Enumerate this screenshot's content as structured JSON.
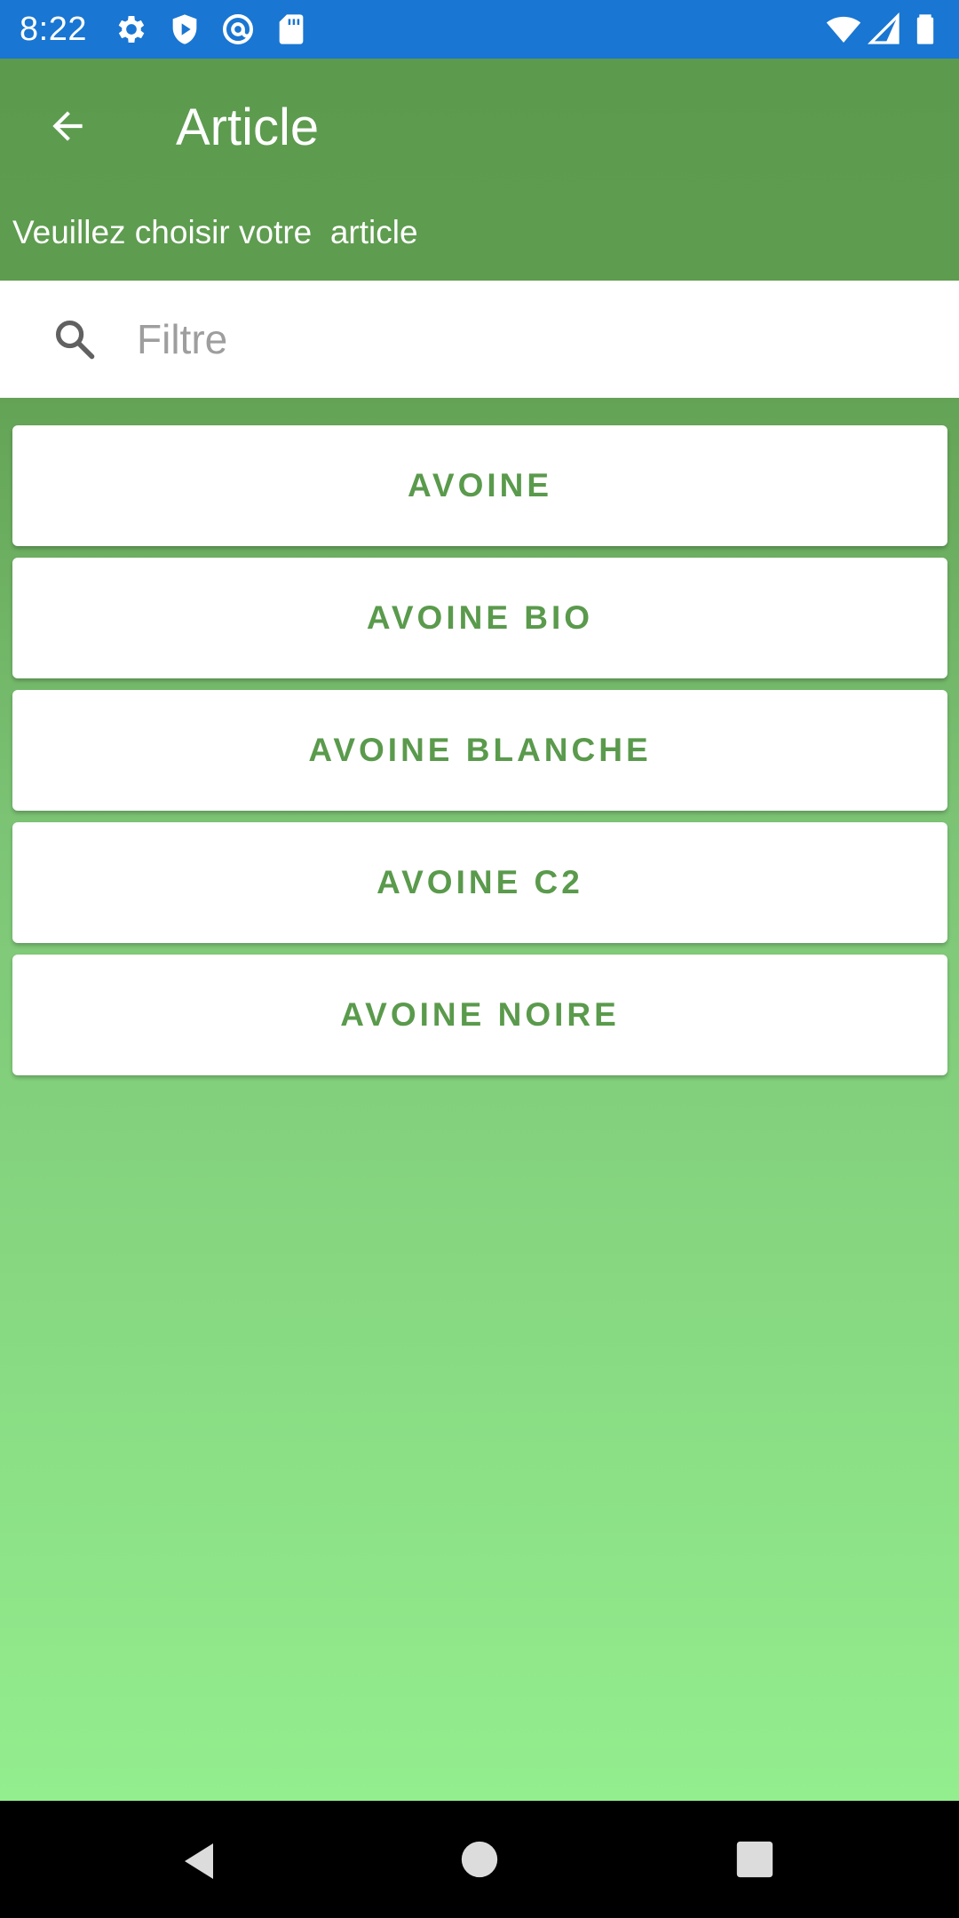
{
  "status_bar": {
    "time": "8:22",
    "left_icons": [
      "gear-icon",
      "shield-icon",
      "at-sign-icon",
      "sd-card-icon"
    ],
    "right_icons": [
      "wifi-icon",
      "signal-icon",
      "battery-icon"
    ]
  },
  "toolbar": {
    "title": "Article",
    "back_icon": "arrow-back-icon"
  },
  "subtitle": "Veuillez choisir votre  article",
  "search": {
    "placeholder": "Filtre",
    "value": ""
  },
  "items": [
    {
      "label": "AVOINE"
    },
    {
      "label": "AVOINE BIO"
    },
    {
      "label": "AVOINE BLANCHE"
    },
    {
      "label": "AVOINE C2"
    },
    {
      "label": "AVOINE NOIRE"
    }
  ],
  "nav_bar": {
    "icons": [
      "nav-back-icon",
      "nav-home-icon",
      "nav-recents-icon"
    ]
  },
  "colors": {
    "status_bar": "#1976d2",
    "toolbar_green": "#5c9a4e",
    "gradient_bottom": "#93ee8e",
    "item_text": "#5a9a4c"
  }
}
